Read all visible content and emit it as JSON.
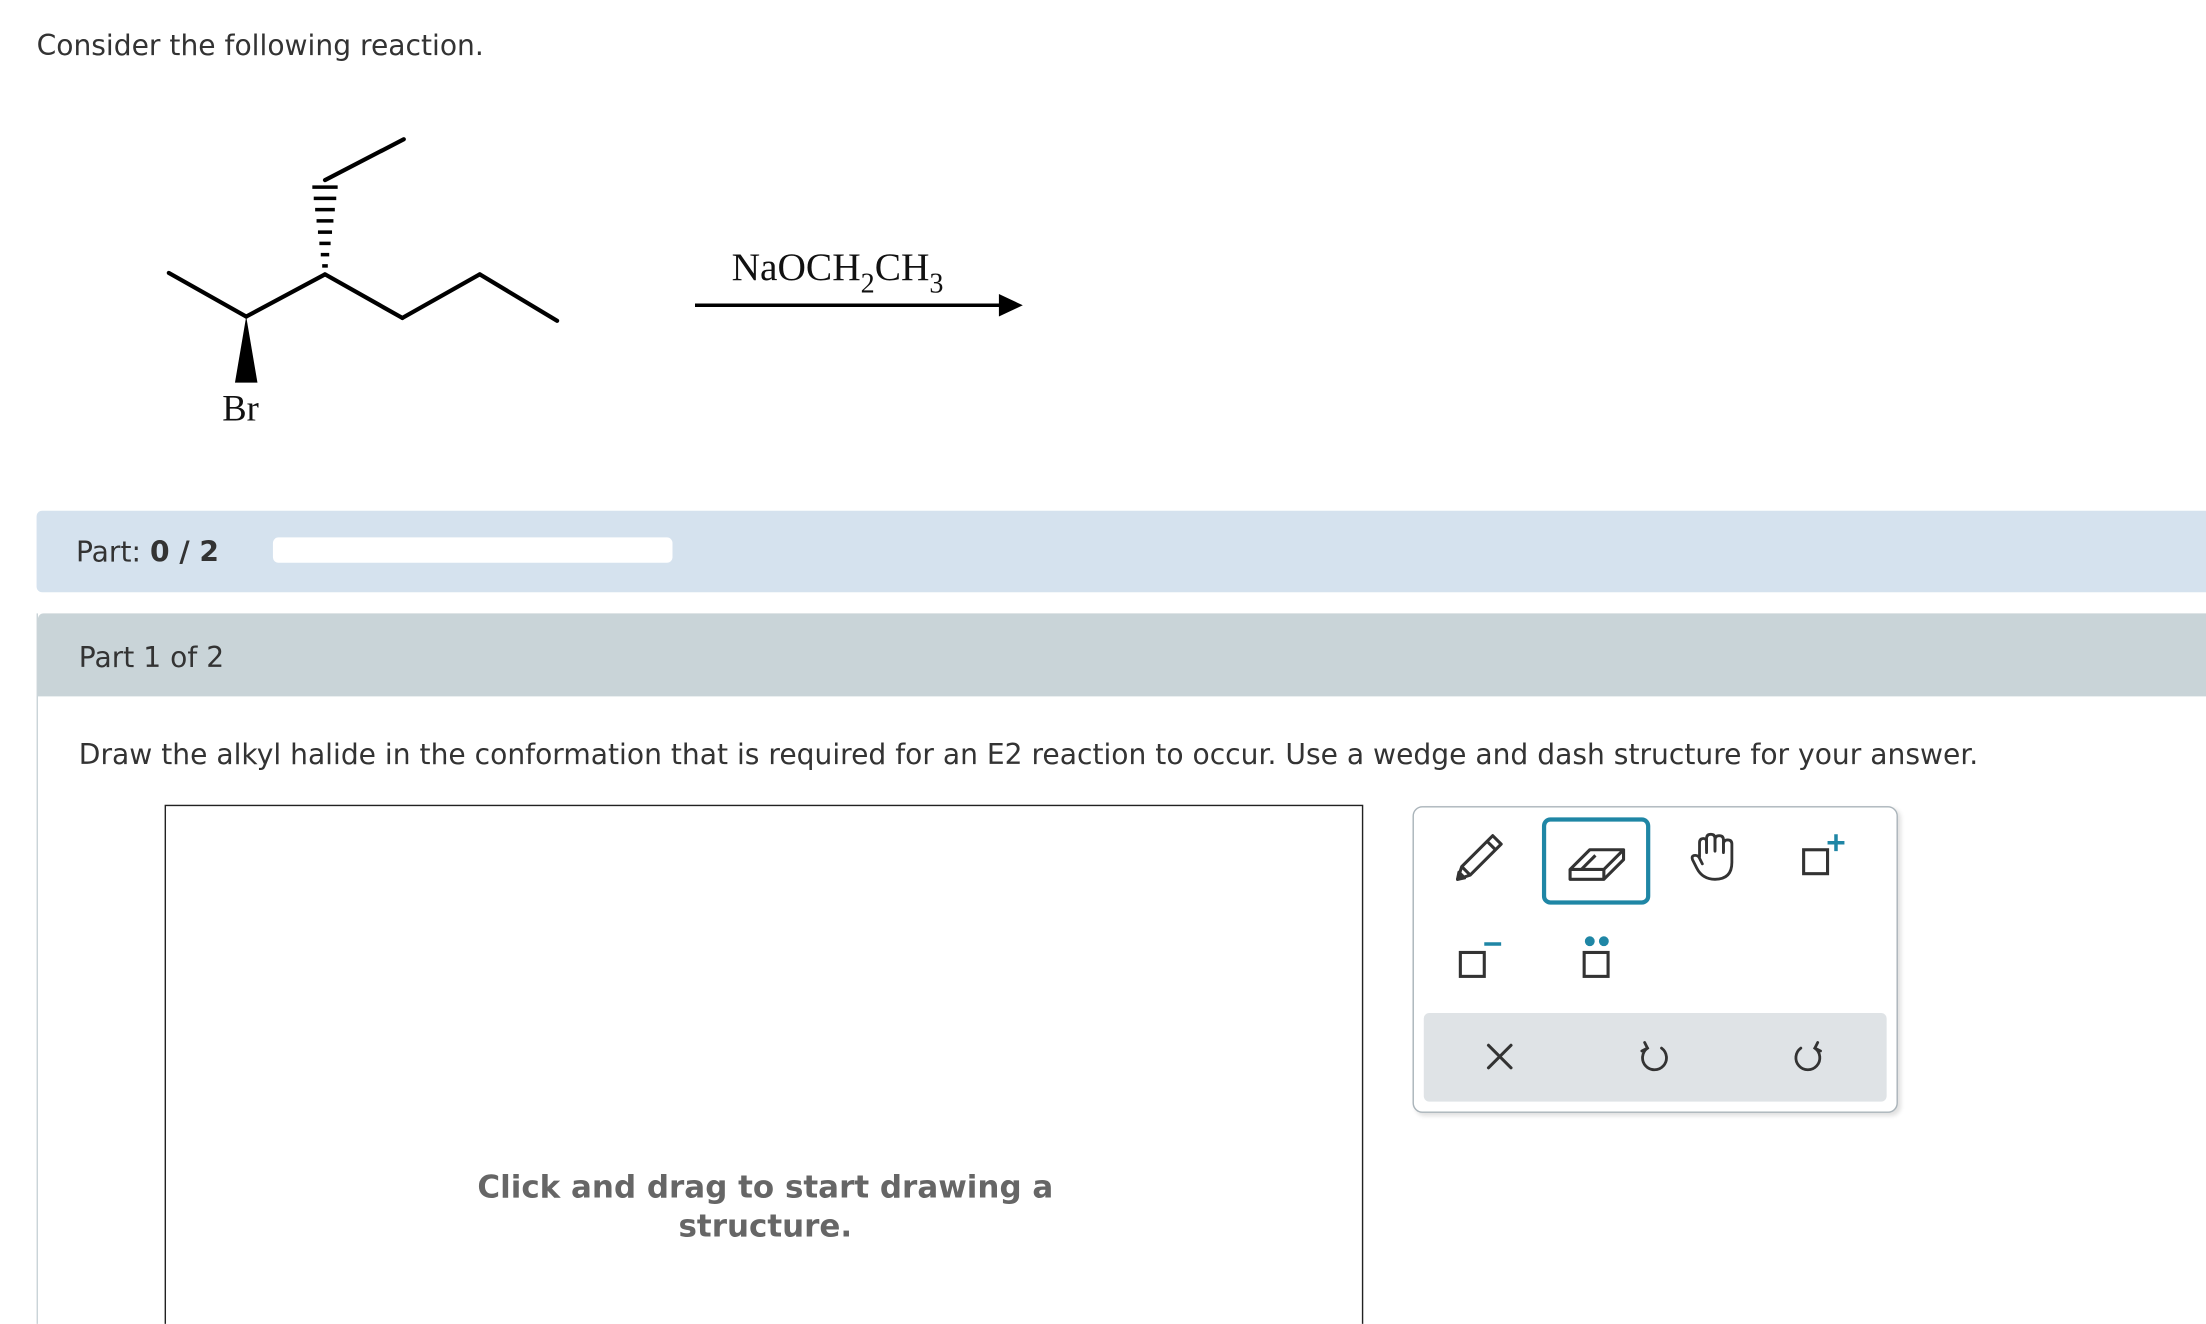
{
  "question": {
    "prompt": "Consider the following reaction.",
    "reaction": {
      "substituent_label": "Br",
      "reagent": {
        "main": "NaOCH",
        "sub1": "2",
        "mid": "CH",
        "sub2": "3"
      }
    }
  },
  "part_progress": {
    "label": "Part:",
    "value": "0 / 2",
    "fraction_complete": 0
  },
  "part": {
    "header": "Part 1 of 2",
    "instruction": "Draw the alkyl halide in the conformation that is required for an E2 reaction to occur. Use a wedge and dash structure for your answer."
  },
  "canvas": {
    "hint_line1": "Click and drag to start drawing a",
    "hint_line2": "structure."
  },
  "toolbox": {
    "tools": [
      {
        "icon": "pencil-icon",
        "active": false
      },
      {
        "icon": "eraser-icon",
        "active": true
      },
      {
        "icon": "hand-icon",
        "active": false
      },
      {
        "icon": "add-positive-charge-icon",
        "active": false
      },
      {
        "icon": "add-negative-charge-icon",
        "active": false
      },
      {
        "icon": "add-lone-pair-icon",
        "active": false
      }
    ],
    "actions": [
      "clear-icon",
      "undo-icon",
      "redo-icon"
    ],
    "accent_color": "#1f86a5",
    "charge_color": "#1f86a5"
  },
  "colors": {
    "part_bar_bg": "#d5e2ee",
    "part_header_bg": "#c9d4d8"
  }
}
